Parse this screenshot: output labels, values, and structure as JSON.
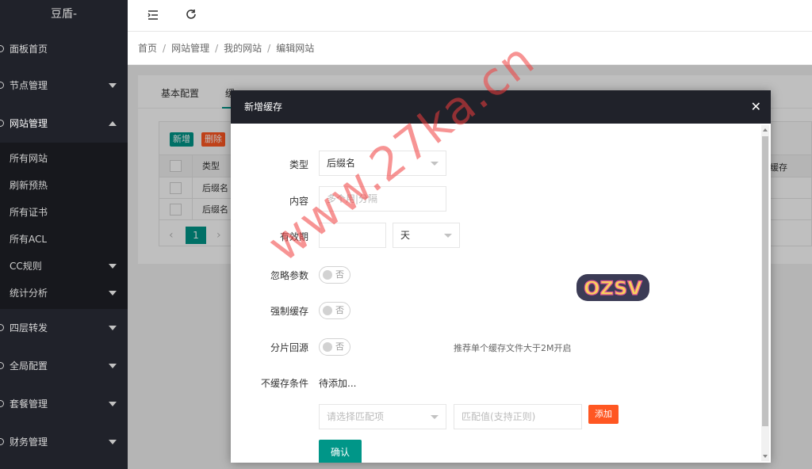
{
  "sidebar": {
    "logo": "豆盾-",
    "items": [
      {
        "label": "面板首页"
      },
      {
        "label": "节点管理"
      },
      {
        "label": "网站管理"
      },
      {
        "label": "四层转发"
      },
      {
        "label": "全局配置"
      },
      {
        "label": "套餐管理"
      },
      {
        "label": "财务管理"
      }
    ],
    "subitems": [
      {
        "label": "所有网站"
      },
      {
        "label": "刷新预热"
      },
      {
        "label": "所有证书"
      },
      {
        "label": "所有ACL"
      },
      {
        "label": "CC规则"
      },
      {
        "label": "统计分析"
      }
    ]
  },
  "breadcrumb": [
    "首页",
    "网站管理",
    "我的网站",
    "编辑网站"
  ],
  "background": {
    "tabs": [
      "基本配置",
      "缓"
    ],
    "add_btn": "新增",
    "del_btn": "删除",
    "col_type": "类型",
    "col_right": "缓存",
    "rows": [
      "后缀名",
      "后缀名"
    ],
    "page": "1"
  },
  "modal": {
    "title": "新增缓存",
    "type_label": "类型",
    "type_value": "后缀名",
    "content_label": "内容",
    "content_placeholder": "多个用|分隔",
    "expire_label": "有效期",
    "expire_value": "",
    "expire_unit": "天",
    "ignore_label": "忽略参数",
    "ignore_value": "否",
    "force_label": "强制缓存",
    "force_value": "否",
    "slice_label": "分片回源",
    "slice_value": "否",
    "slice_hint": "推荐单个缓存文件大于2M开启",
    "nocache_label": "不缓存条件",
    "nocache_value": "待添加...",
    "match_placeholder": "请选择匹配项",
    "match_value_placeholder": "匹配值(支持正则)",
    "add_btn": "添加",
    "confirm_btn": "确认"
  },
  "sticker_text": "OZSV",
  "watermark": "www.27ka.cn",
  "colors": {
    "sidebar": "#20222a",
    "primary": "#009688",
    "danger": "#ff5722"
  }
}
